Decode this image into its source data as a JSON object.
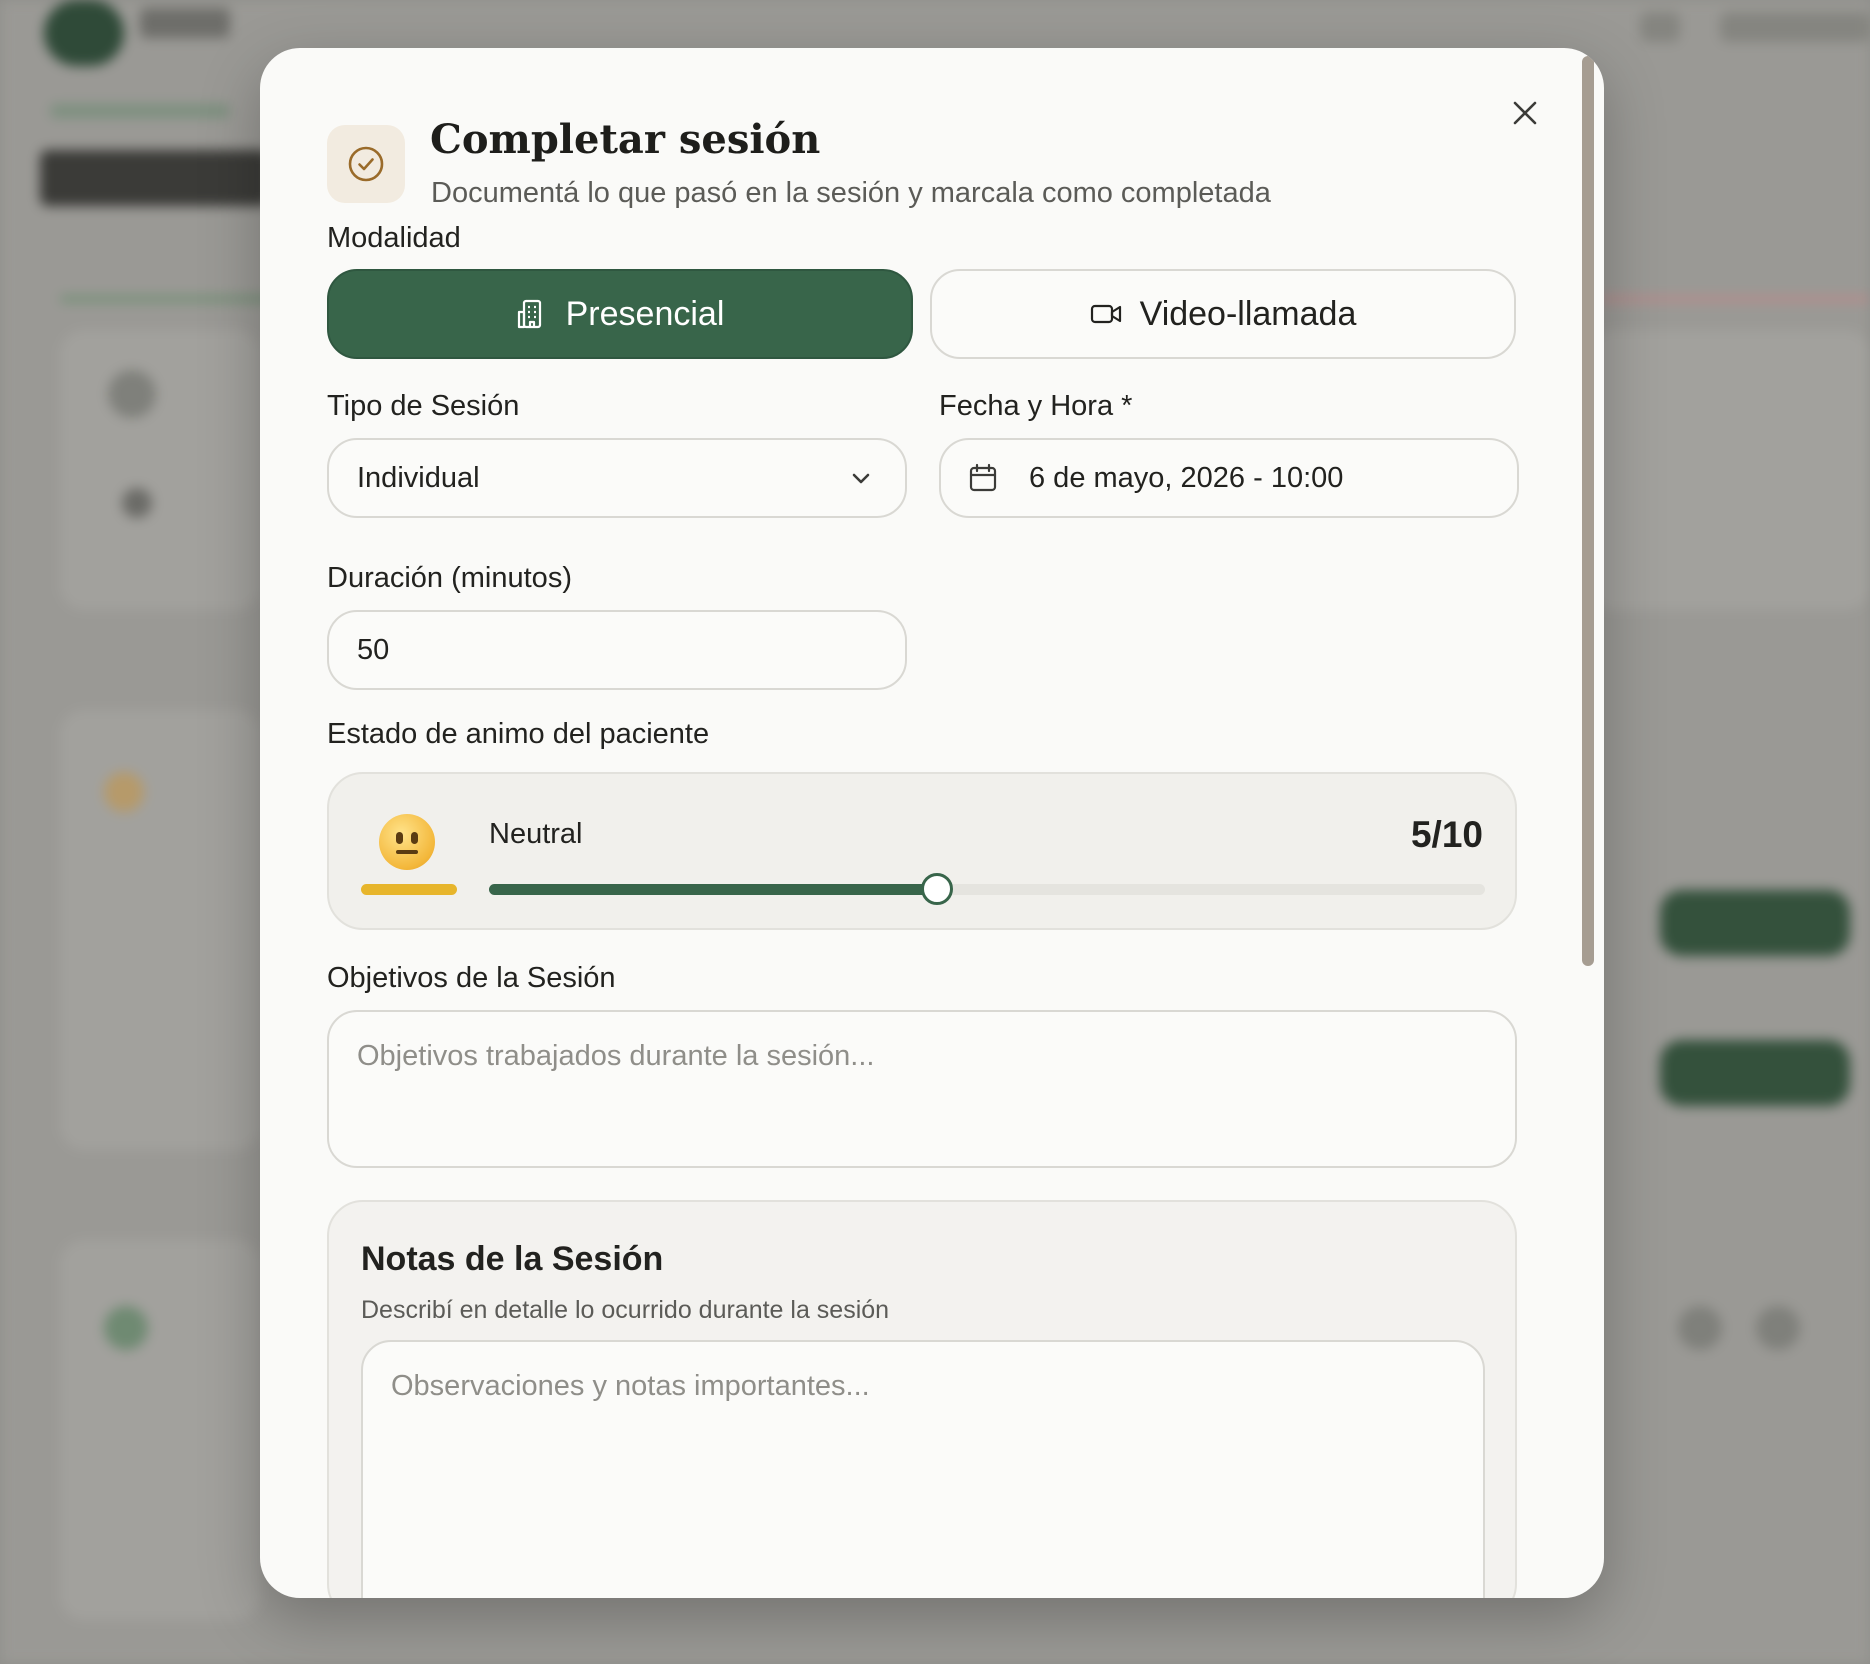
{
  "modal": {
    "title": "Completar sesión",
    "subtitle": "Documentá lo que pasó en la sesión y marcala como completada",
    "close_icon": "close-icon",
    "header_icon": "check-circle-icon"
  },
  "modalidad": {
    "label": "Modalidad",
    "options": [
      {
        "label": "Presencial",
        "icon": "building-icon",
        "selected": true
      },
      {
        "label": "Video-llamada",
        "icon": "video-camera-icon",
        "selected": false
      }
    ]
  },
  "tipo_sesion": {
    "label": "Tipo de Sesión",
    "value": "Individual"
  },
  "fecha_hora": {
    "label": "Fecha y Hora *",
    "value": "6 de mayo, 2026 - 10:00"
  },
  "duracion": {
    "label": "Duración (minutos)",
    "value": "50"
  },
  "estado_animo": {
    "label": "Estado de animo del paciente",
    "mood_label": "Neutral",
    "score_text": "5/10",
    "value": 5,
    "max": 10,
    "emoji": "neutral-face-icon"
  },
  "objetivos": {
    "label": "Objetivos de la Sesión",
    "placeholder": "Objetivos trabajados durante la sesión..."
  },
  "notas": {
    "title": "Notas de la Sesión",
    "subtitle": "Describí en detalle lo ocurrido durante la sesión",
    "placeholder": "Observaciones y notas importantes..."
  },
  "colors": {
    "accent": "#38654a",
    "mood_bar": "#e7b52b",
    "header_icon": "#9a6b2a"
  }
}
